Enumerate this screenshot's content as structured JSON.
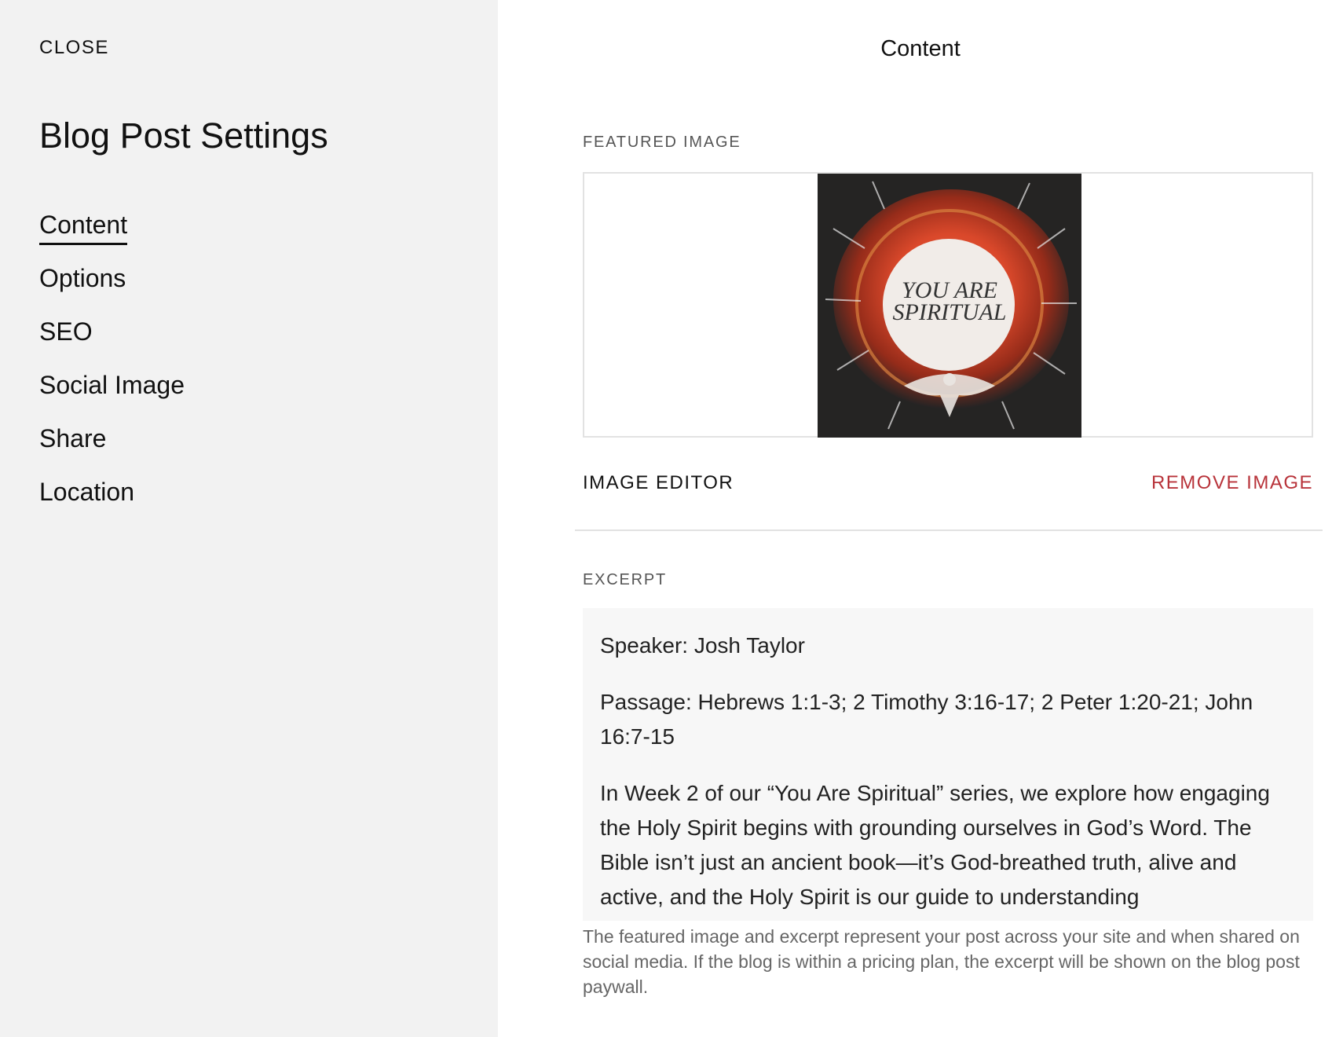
{
  "sidebar": {
    "close_label": "CLOSE",
    "title": "Blog Post Settings",
    "items": [
      {
        "label": "Content",
        "active": true
      },
      {
        "label": "Options",
        "active": false
      },
      {
        "label": "SEO",
        "active": false
      },
      {
        "label": "Social Image",
        "active": false
      },
      {
        "label": "Share",
        "active": false
      },
      {
        "label": "Location",
        "active": false
      }
    ]
  },
  "main": {
    "title": "Content",
    "featured_image": {
      "label": "FEATURED IMAGE",
      "image_text_line1": "YOU ARE",
      "image_text_line2": "SPIRITUAL",
      "image_editor_label": "IMAGE EDITOR",
      "remove_image_label": "REMOVE IMAGE"
    },
    "excerpt": {
      "label": "EXCERPT",
      "paragraphs": [
        "Speaker: Josh Taylor",
        "Passage: Hebrews 1:1-3; 2 Timothy 3:16-17; 2 Peter 1:20-21; John 16:7-15",
        "In Week 2 of our “You Are Spiritual” series, we explore how engaging the Holy Spirit begins with grounding ourselves in God’s Word. The Bible isn’t just an ancient book—it’s God-breathed truth, alive and active, and the Holy Spirit is our guide to understanding"
      ],
      "help_text": "The featured image and excerpt represent your post across your site and when shared on social media. If the blog is within a pricing plan, the excerpt will be shown on the blog post paywall."
    }
  },
  "colors": {
    "sidebar_bg": "#f2f2f2",
    "remove_red": "#b8333a",
    "excerpt_bg": "#f7f7f7"
  }
}
